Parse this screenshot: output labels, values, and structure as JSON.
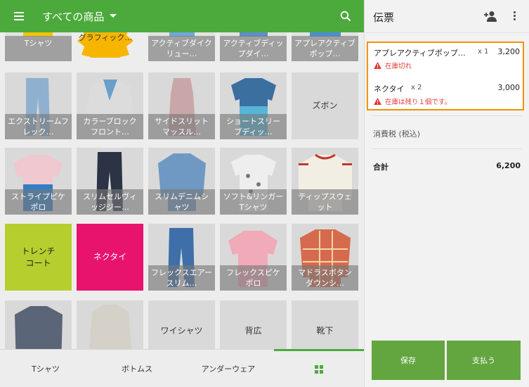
{
  "header": {
    "title": "すべての商品"
  },
  "icons": {
    "menu": "menu-icon",
    "search": "search-icon",
    "dropdown": "chevron-down-icon",
    "add_person": "add-person-icon",
    "more": "more-vert-icon",
    "warning": "warning-icon",
    "grid": "grid-view-icon"
  },
  "colors": {
    "accent": "#4caa3c",
    "warning_border": "#f39200",
    "warning_text": "#e53935",
    "button": "#63a63f",
    "lime": "#b6cf2f",
    "pink": "#e8136d"
  },
  "products": [
    "Tシャツ",
    "グラフィック…",
    "アクティブダイクリュー…",
    "アクティブディップダイ…",
    "アプレアクティブポップ…",
    "エクストリームフレック…",
    "カラーブロックフロント…",
    "サイドスリットマッスル…",
    "ショートスリーブディッ…",
    "ズボン",
    "ストライプピケポロ",
    "スリムセルヴィッジジー…",
    "スリムデニムシャツ",
    "ソフト&リンガーTシャツ",
    "ティップスウェット",
    "トレンチコート",
    "ネクタイ",
    "フレックスエアースリム…",
    "フレックスピケポロ",
    "マドラスボタンダウンシ…",
    "",
    "",
    "ワイシャツ",
    "背広",
    "靴下"
  ],
  "tabs": [
    "Tシャツ",
    "ボトムス",
    "アンダーウェア"
  ],
  "ticket": {
    "title": "伝票",
    "lines": [
      {
        "name": "アプレアクティブポップ…",
        "qty": "x 1",
        "price": "3,200",
        "warning": "在庫切れ"
      },
      {
        "name": "ネクタイ",
        "qty": "x 2",
        "price": "3,000",
        "warning": "在庫は残り１個です。"
      }
    ],
    "tax_label": "消費税 (税込)",
    "total_label": "合計",
    "total_value": "6,200",
    "save_label": "保存",
    "pay_label": "支払う"
  }
}
